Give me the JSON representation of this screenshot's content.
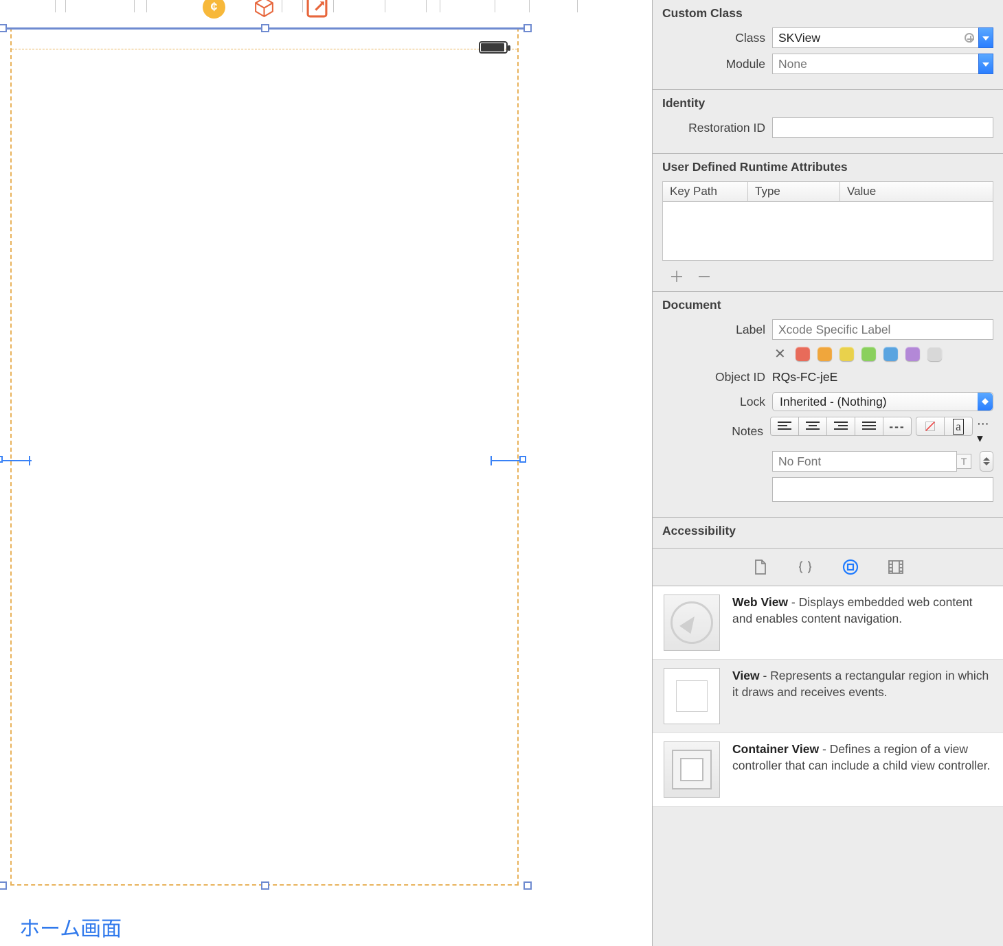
{
  "canvas": {
    "tab_label": "ホーム画面"
  },
  "inspector": {
    "custom_class": {
      "title": "Custom Class",
      "class_label": "Class",
      "class_value": "SKView",
      "module_label": "Module",
      "module_placeholder": "None"
    },
    "identity": {
      "title": "Identity",
      "restoration_label": "Restoration ID",
      "restoration_value": ""
    },
    "udra": {
      "title": "User Defined Runtime Attributes",
      "columns": [
        "Key Path",
        "Type",
        "Value"
      ]
    },
    "document": {
      "title": "Document",
      "label_label": "Label",
      "label_placeholder": "Xcode Specific Label",
      "object_id_label": "Object ID",
      "object_id_value": "RQs-FC-jeE",
      "lock_label": "Lock",
      "lock_value": "Inherited - (Nothing)",
      "notes_label": "Notes",
      "font_placeholder": "No Font",
      "swatch_colors": [
        "#e86b5a",
        "#f0a63c",
        "#e9d14c",
        "#8ad05d",
        "#5aa4e0",
        "#b388d7",
        "#bdbdbd"
      ]
    },
    "accessibility": {
      "title": "Accessibility"
    }
  },
  "library": {
    "items": [
      {
        "title": "Web View",
        "desc": " - Displays embedded web content and enables content navigation."
      },
      {
        "title": "View",
        "desc": " - Represents a rectangular region in which it draws and receives events."
      },
      {
        "title": "Container View",
        "desc": " - Defines a region of a view controller that can include a child view controller."
      }
    ]
  }
}
